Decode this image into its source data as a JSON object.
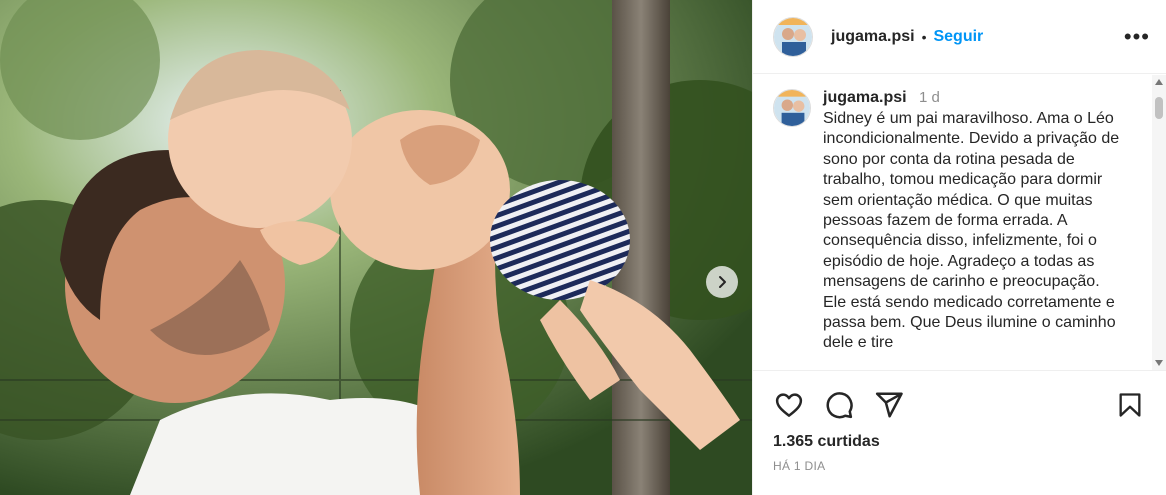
{
  "post": {
    "username": "jugama.psi",
    "separator": "•",
    "follow_label": "Seguir",
    "more_label": "•••",
    "caption": {
      "username": "jugama.psi",
      "time": "1 d",
      "text": "Sidney é um pai maravilhoso. Ama o Léo incondicionalmente. Devido a privação de sono por conta da rotina pesada de trabalho, tomou medicação para dormir sem orientação médica. O que muitas pessoas fazem de forma errada. A consequência disso, infelizmente, foi o episódio de hoje. Agradeço a todas as mensagens de carinho e preocupação. Ele está sendo medicado corretamente e passa bem. Que Deus ilumine o caminho dele e tire"
    },
    "likes": "1.365 curtidas",
    "posted_ago": "HÁ 1 DIA"
  },
  "icons": {
    "like": "heart-icon",
    "comment": "comment-icon",
    "share": "paper-plane-icon",
    "save": "bookmark-icon",
    "next": "chevron-right-icon",
    "more": "more-horizontal-icon"
  },
  "colors": {
    "accent": "#0095f6",
    "text": "#262626",
    "muted": "#8e8e8e"
  }
}
